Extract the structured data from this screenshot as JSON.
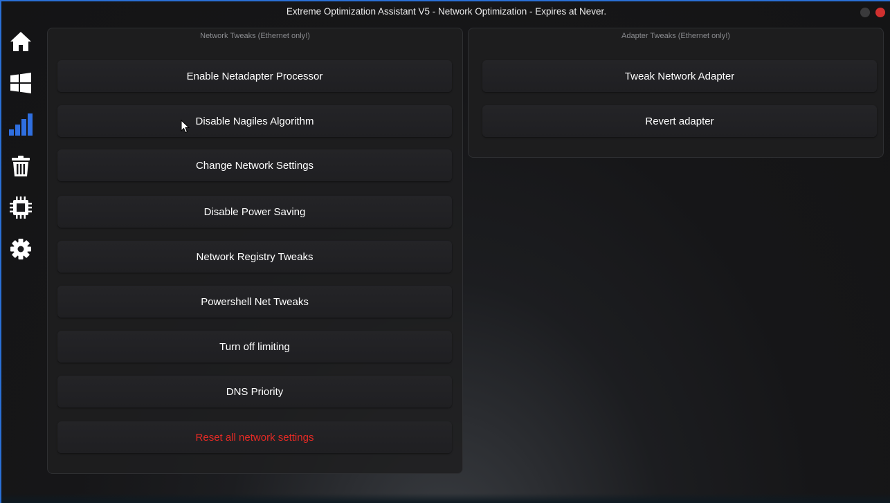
{
  "window": {
    "title": "Extreme Optimization Assistant V5 - Network Optimization - Expires at Never."
  },
  "sidebar": {
    "items": [
      {
        "icon": "home-icon",
        "active": false
      },
      {
        "icon": "windows-icon",
        "active": false
      },
      {
        "icon": "signal-bars-icon",
        "active": true
      },
      {
        "icon": "trash-icon",
        "active": false
      },
      {
        "icon": "cpu-chip-icon",
        "active": false
      },
      {
        "icon": "gear-icon",
        "active": false
      }
    ]
  },
  "network_panel": {
    "title": "Network Tweaks (Ethernet only!)",
    "buttons": [
      {
        "label": "Enable Netadapter Processor"
      },
      {
        "label": "Disable Nagiles Algorithm"
      },
      {
        "label": "Change Network Settings"
      },
      {
        "label": "Disable Power Saving"
      },
      {
        "label": "Network Registry Tweaks"
      },
      {
        "label": "Powershell Net Tweaks"
      },
      {
        "label": "Turn off limiting"
      },
      {
        "label": "DNS Priority"
      },
      {
        "label": "Reset all network settings"
      }
    ]
  },
  "adapter_panel": {
    "title": "Adapter Tweaks (Ethernet only!)",
    "buttons": [
      {
        "label": "Tweak Network Adapter"
      },
      {
        "label": "Revert adapter"
      }
    ]
  },
  "colors": {
    "accent_blue": "#2a6fd6",
    "danger_red": "#e52a25",
    "close_button": "#d0302f"
  }
}
